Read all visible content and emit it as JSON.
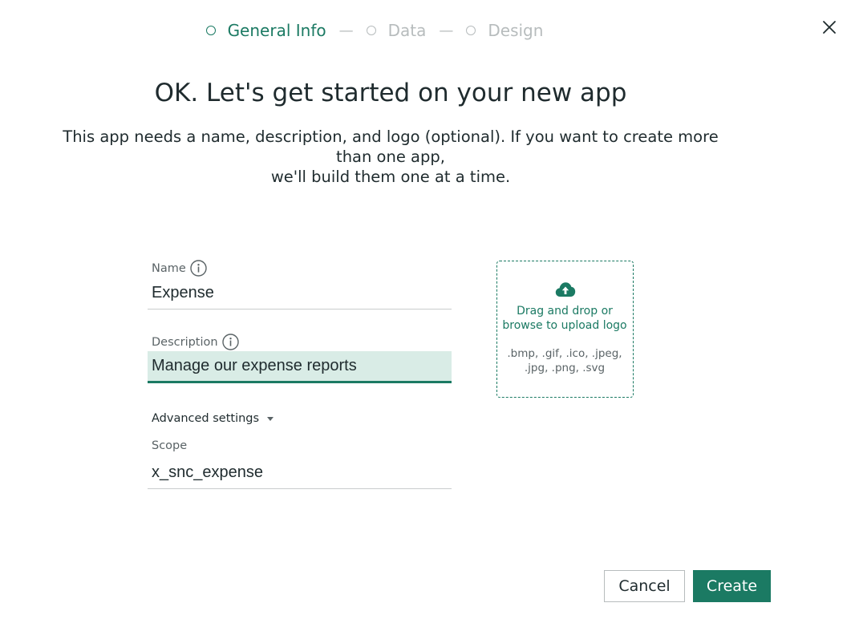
{
  "stepper": {
    "steps": [
      {
        "label": "General Info",
        "state": "active"
      },
      {
        "label": "Data",
        "state": "inactive"
      },
      {
        "label": "Design",
        "state": "inactive"
      }
    ],
    "separator": "—"
  },
  "heading": {
    "title": "OK. Let's get started on your new app",
    "subtitle_line1": "This app needs a name, description, and logo (optional). If you want to create more than one app,",
    "subtitle_line2": "we'll build them one at a time."
  },
  "form": {
    "name": {
      "label": "Name",
      "value": "Expense"
    },
    "description": {
      "label": "Description",
      "value": "Manage our expense reports"
    },
    "advanced_label": "Advanced settings",
    "scope": {
      "label": "Scope",
      "value": "x_snc_expense"
    }
  },
  "upload": {
    "line1": "Drag and drop or",
    "line2": "browse to upload logo",
    "formats_line1": ".bmp, .gif, .ico, .jpeg,",
    "formats_line2": ".jpg, .png, .svg",
    "icon": "cloud-upload-icon"
  },
  "buttons": {
    "cancel": "Cancel",
    "create": "Create"
  },
  "colors": {
    "accent": "#1b7a63",
    "focused_field_bg": "#d9ece6",
    "inactive": "#b7bcbd",
    "text": "#1f2b2e"
  }
}
